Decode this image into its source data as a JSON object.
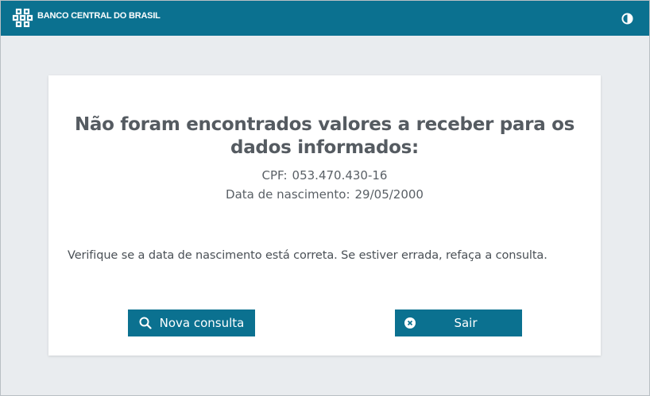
{
  "header": {
    "brand": "BANCO CENTRAL DO BRASIL",
    "logo_icon": "bcb-logo-icon",
    "contrast_icon": "contrast-toggle-icon",
    "background_color": "#0b7190"
  },
  "result": {
    "title": "Não foram encontrados valores a receber para os dados informados:",
    "cpf_label": "CPF:",
    "cpf_value": "053.470.430-16",
    "birth_label": "Data de nascimento:",
    "birth_value": "29/05/2000",
    "message": "Verifique se a data de nascimento está correta. Se estiver errada, refaça a consulta."
  },
  "actions": {
    "new_query_label": "Nova consulta",
    "new_query_icon": "search-icon",
    "exit_label": "Sair",
    "exit_icon": "close-circle-icon",
    "button_color": "#0b7190"
  }
}
